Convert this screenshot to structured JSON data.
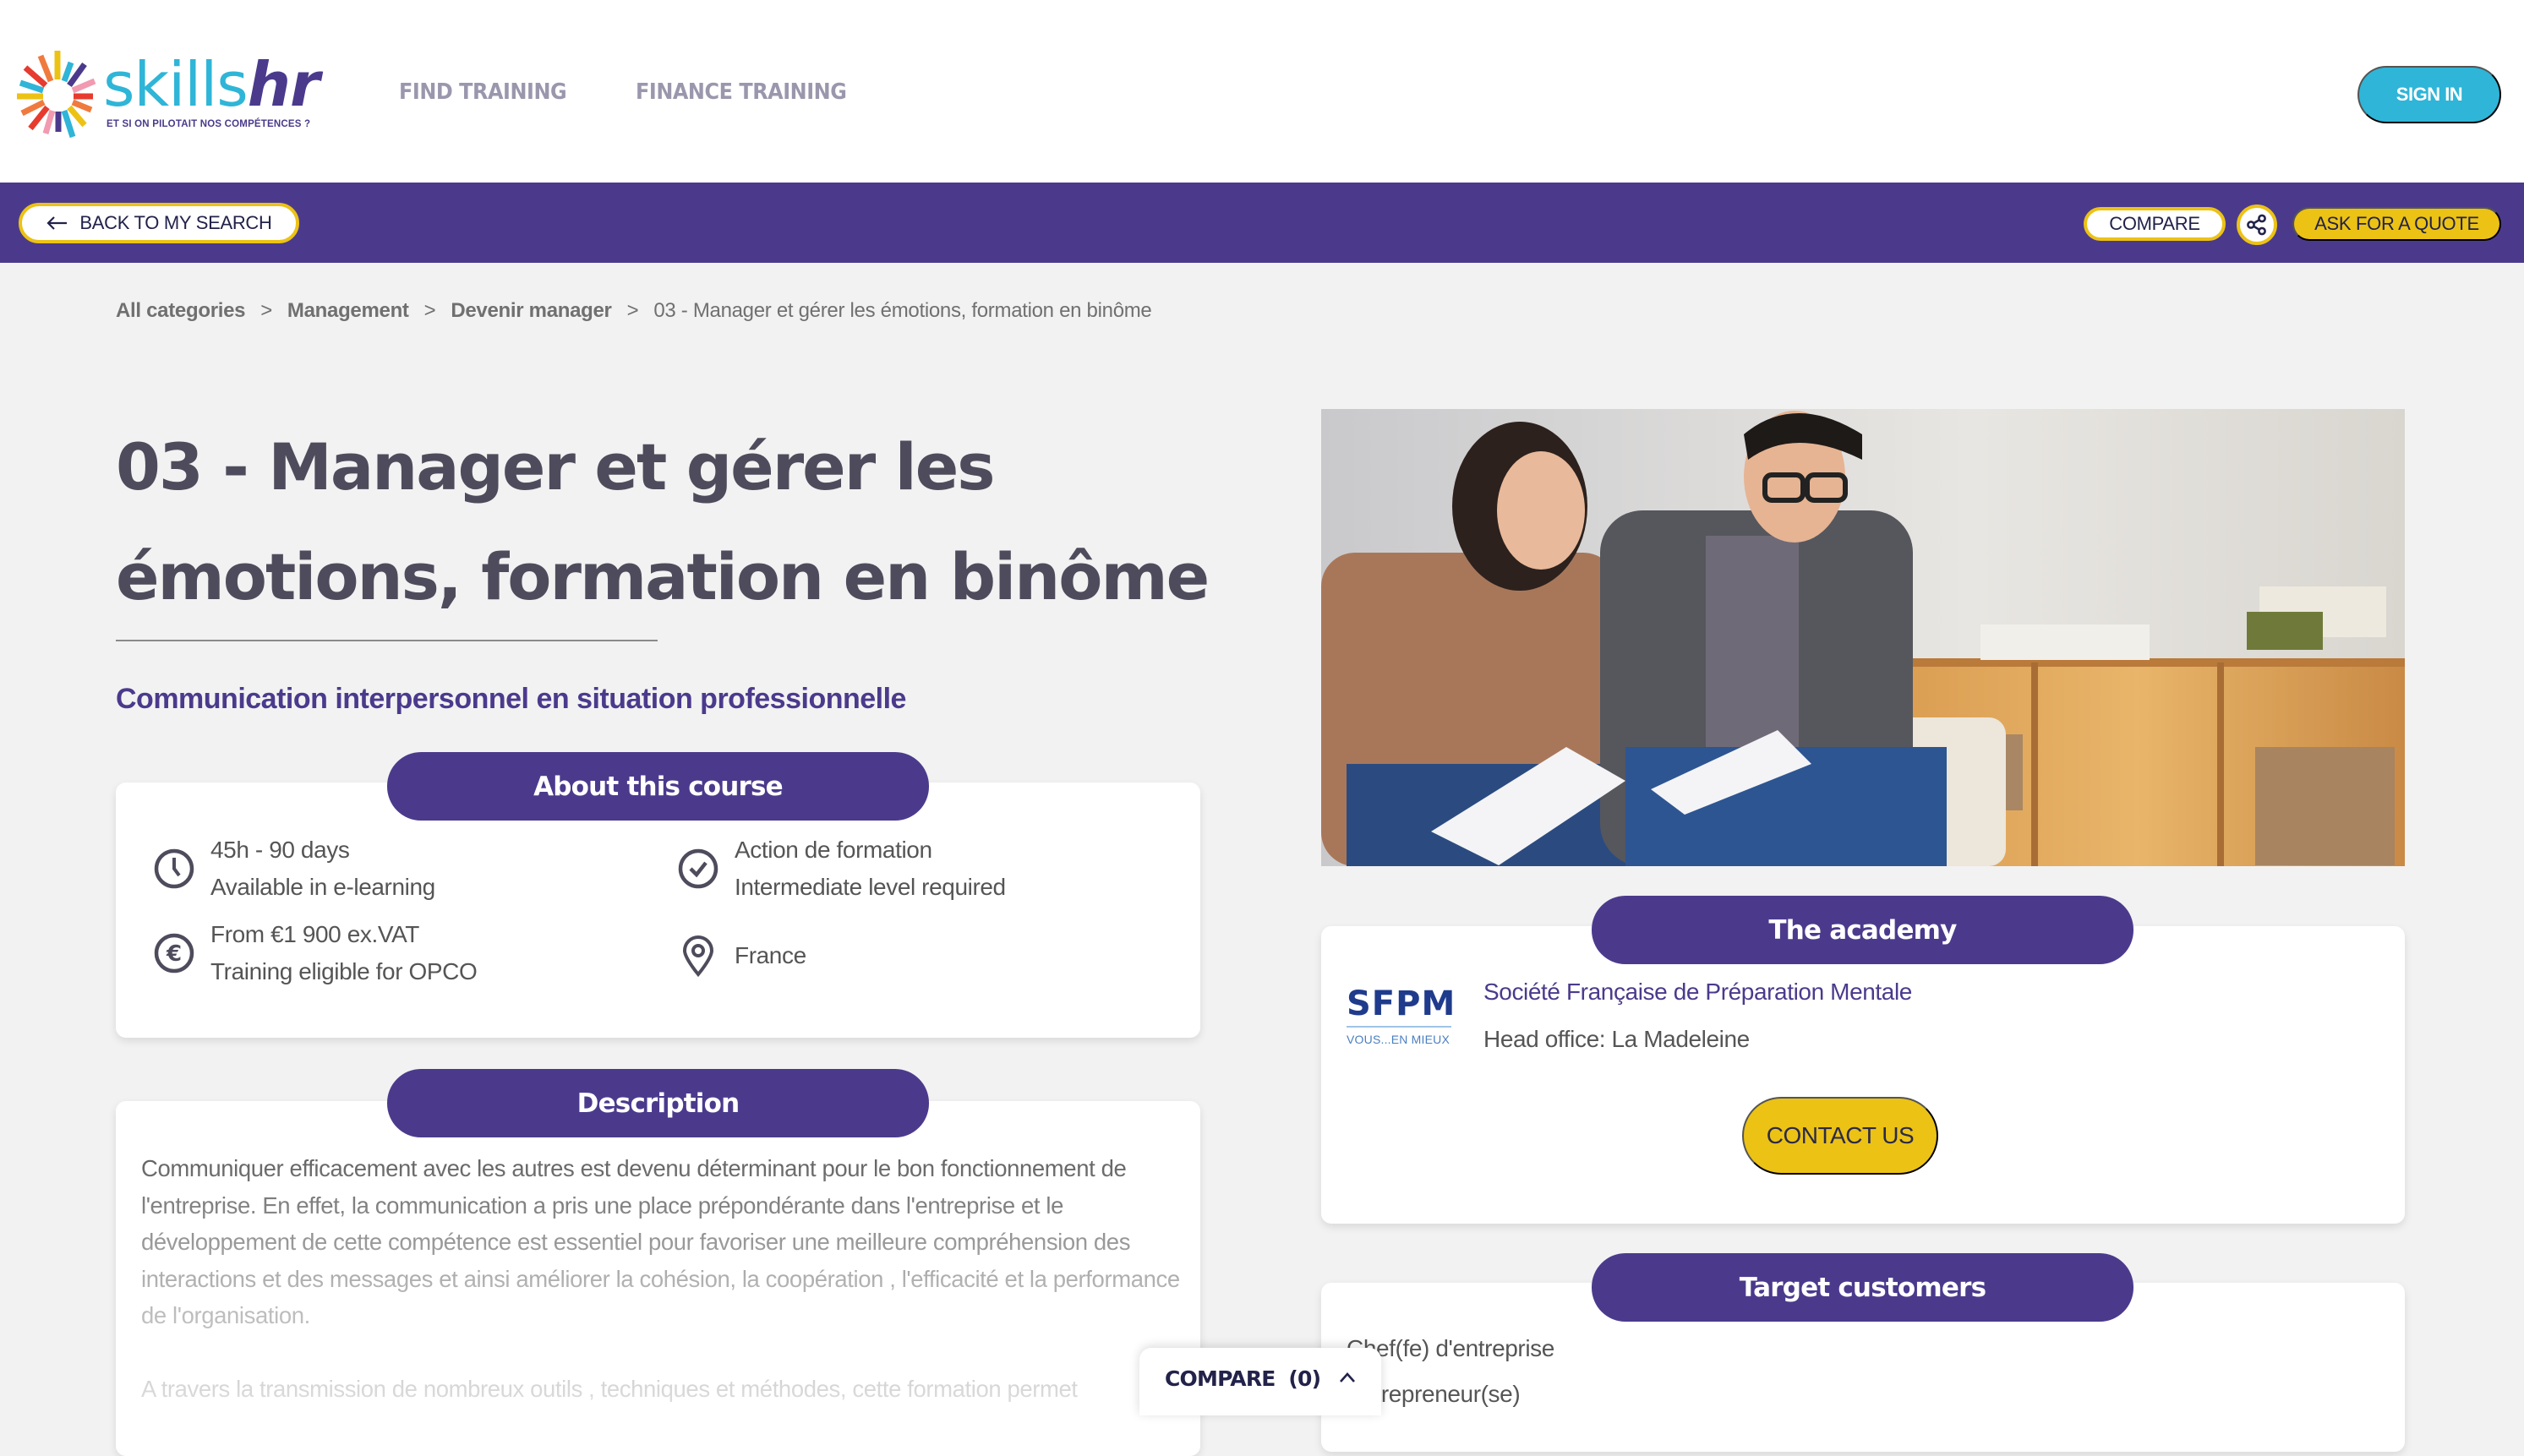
{
  "header": {
    "logo": {
      "brand_part1": "skills",
      "brand_part2": "hr",
      "tagline": "ET SI ON PILOTAIT NOS COMPÉTENCES ?"
    },
    "nav": [
      {
        "label": "FIND TRAINING"
      },
      {
        "label": "FINANCE TRAINING"
      }
    ],
    "sign_in_label": "SIGN IN"
  },
  "action_bar": {
    "back_label": "BACK TO MY SEARCH",
    "compare_label": "COMPARE",
    "share_icon": "share-icon",
    "quote_label": "ASK FOR A QUOTE"
  },
  "breadcrumb": {
    "items": [
      "All categories",
      "Management",
      "Devenir manager"
    ],
    "separator": ">",
    "current": "03 - Manager et gérer les émotions, formation en binôme"
  },
  "course": {
    "title_line1": "03 - Manager et gérer les",
    "title_line2": "émotions, formation en binôme",
    "subtitle": "Communication interpersonnel en situation professionnelle"
  },
  "about": {
    "heading": "About this course",
    "facts": [
      {
        "icon": "clock-icon",
        "line1": "45h - 90 days",
        "line2": "Available in e-learning"
      },
      {
        "icon": "check-circle-icon",
        "line1": "Action de formation",
        "line2": "Intermediate level required"
      },
      {
        "icon": "euro-icon",
        "line1": "From €1 900 ex.VAT",
        "line2": "Training eligible for OPCO"
      },
      {
        "icon": "location-pin-icon",
        "line1": "France",
        "line2": ""
      }
    ]
  },
  "description": {
    "heading": "Description",
    "paragraphs": [
      "Communiquer efficacement avec les autres est devenu déterminant pour le bon fonctionnement de l'entreprise. En effet, la communication a pris une place prépondérante dans l'entreprise et le développement de cette compétence est essentiel pour favoriser une meilleure compréhension des interactions et des messages et ainsi améliorer la cohésion, la coopération , l'efficacité et la performance de l'organisation.",
      "A travers la transmission de nombreux outils , techniques et méthodes, cette formation permet"
    ]
  },
  "academy": {
    "heading": "The academy",
    "logo_text": "SFPM",
    "logo_tagline": "VOUS...EN MIEUX",
    "name": "Société Française de Préparation Mentale",
    "head_office": "Head office: La Madeleine",
    "contact_label": "CONTACT US"
  },
  "target": {
    "heading": "Target customers",
    "items": [
      "Chef(fe) d'entreprise",
      "Entrepreneur(se)"
    ]
  },
  "compare_dock": {
    "label": "COMPARE",
    "count": "(0)"
  },
  "colors": {
    "brand_purple": "#4b3a8c",
    "brand_cyan": "#2fb5d7",
    "accent_yellow": "#ecc215",
    "page_bg": "#f2f2f2",
    "text_gray": "#555555"
  }
}
